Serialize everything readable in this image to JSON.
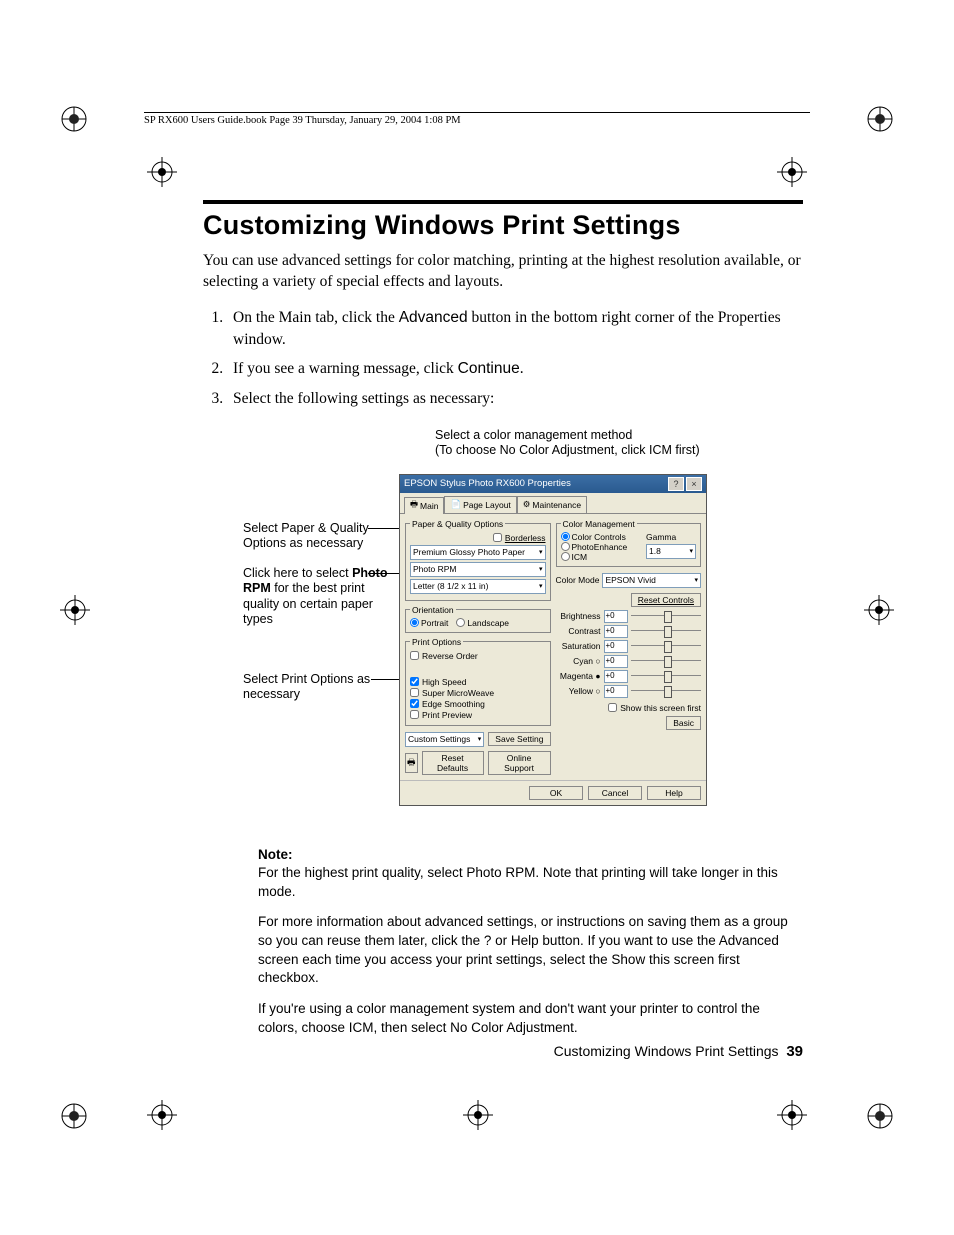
{
  "header_text": "SP RX600 Users Guide.book  Page 39  Thursday, January 29, 2004  1:08 PM",
  "title": "Customizing Windows Print Settings",
  "intro": "You can use advanced settings for color matching, printing at the highest resolution available, or selecting a variety of special effects and layouts.",
  "steps": {
    "s1_a": "On the Main tab, click the ",
    "s1_b": "Advanced",
    "s1_c": " button in the bottom right corner of the Properties window.",
    "s2_a": "If you see a warning message, click ",
    "s2_b": "Continue",
    "s2_c": ".",
    "s3": "Select the following settings as necessary:"
  },
  "fig_top_a": "Select a color management method",
  "fig_top_b": "(To choose ",
  "fig_top_c": "No Color Adjustment",
  "fig_top_d": ", click ",
  "fig_top_e": "ICM",
  "fig_top_f": " first)",
  "callout1": "Select Paper & Quality Options as necessary",
  "callout2_a": "Click here to select ",
  "callout2_b": "Photo RPM",
  "callout2_c": " for the best print quality on certain paper types",
  "callout3": "Select Print Options as necessary",
  "dialog": {
    "title": "EPSON Stylus Photo RX600 Properties",
    "tabs": {
      "main": "Main",
      "layout": "Page Layout",
      "maint": "Maintenance"
    },
    "paper_legend": "Paper & Quality Options",
    "borderless": "Borderless",
    "media": "Premium Glossy Photo Paper",
    "quality": "Photo RPM",
    "size": "Letter (8 1/2 x 11 in)",
    "orient_legend": "Orientation",
    "portrait": "Portrait",
    "landscape": "Landscape",
    "printopt_legend": "Print Options",
    "reverse": "Reverse Order",
    "highspeed": "High Speed",
    "microweave": "Super MicroWeave",
    "edge": "Edge Smoothing",
    "preview": "Print Preview",
    "custom": "Custom Settings",
    "save": "Save Setting",
    "reset": "Reset Defaults",
    "support": "Online Support",
    "cm_legend": "Color Management",
    "cc": "Color Controls",
    "pe": "PhotoEnhance",
    "icm": "ICM",
    "gamma_lbl": "Gamma",
    "gamma_val": "1.8",
    "mode_lbl": "Color Mode",
    "mode_val": "EPSON Vivid",
    "resetc": "Reset Controls",
    "brightness": "Brightness",
    "contrast": "Contrast",
    "saturation": "Saturation",
    "cyan": "Cyan ○",
    "magenta": "Magenta ●",
    "yellow": "Yellow ○",
    "zero": "+0",
    "showfirst": "Show this screen first",
    "basic": "Basic",
    "ok": "OK",
    "cancel": "Cancel",
    "help": "Help"
  },
  "note": {
    "label": "Note:",
    "p1_a": "For the highest print quality, select ",
    "p1_b": "Photo RPM",
    "p1_c": ". Note that printing will take longer in this mode.",
    "p2_a": "For more information about advanced settings, or instructions on saving them as a group so you can reuse them later, click the ",
    "p2_b": "?",
    "p2_c": " or ",
    "p2_d": "Help",
    "p2_e": " button. If you want to use the Advanced screen each time you access your print settings, select the ",
    "p2_f": "Show this screen first",
    "p2_g": " checkbox.",
    "p3_a": "If you're using a color management system and don't want your printer to control the colors, choose ",
    "p3_b": "ICM",
    "p3_c": ", then select ",
    "p3_d": "No Color Adjustment",
    "p3_e": "."
  },
  "footer_text": "Customizing Windows Print Settings",
  "page_no": "39"
}
